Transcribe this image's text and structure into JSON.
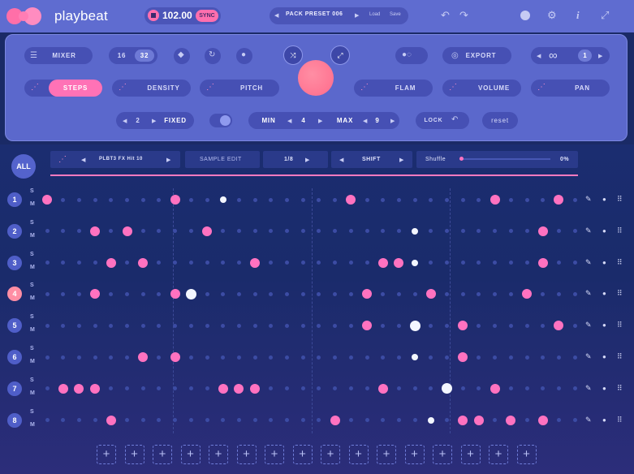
{
  "app": {
    "brand": "playbeat",
    "logo_icon": "playbeat-logo-icon"
  },
  "transport": {
    "bpm": "102.00",
    "sync_label": "SYNC"
  },
  "preset": {
    "name": "PACK PRESET 006",
    "load_label": "Load",
    "save_label": "Save"
  },
  "top_icons": [
    "undo-icon",
    "redo-icon",
    "record-icon",
    "settings-gear-icon",
    "info-icon",
    "expand-icon"
  ],
  "controls": {
    "mixer_label": "MIXER",
    "steps_16": "16",
    "steps_32": "32",
    "export_label": "EXPORT",
    "loop_count": "1",
    "steps_label": "STEPS",
    "density_label": "DENSITY",
    "pitch_label": "PITCH",
    "flam_label": "FLAM",
    "volume_label": "VOLUME",
    "pan_label": "PAN",
    "fixed_value": "2",
    "fixed_label": "FIXED",
    "min_label": "MIN",
    "min_value": "4",
    "max_label": "MAX",
    "max_value": "9",
    "lock_label": "LOCK",
    "reset_label": "reset"
  },
  "sequencer": {
    "all_label": "ALL",
    "sample_name": "PLBT3 FX Hit 10",
    "sample_edit_label": "SAMPLE EDIT",
    "division": "1/8",
    "shift_label": "SHIFT",
    "shuffle_label": "Shuffle",
    "shuffle_value": "0%",
    "solo_label": "S",
    "mute_label": "M",
    "rows": [
      {
        "num": "1",
        "steps": "p.......p..w.......p........p...p..."
      },
      {
        "num": "2",
        "steps": "...p.p....p............w.......p.."
      },
      {
        "num": "3",
        "steps": "....p.p......p.......ppw.......p.."
      },
      {
        "num": "4",
        "steps": "...p....pW..........p...p.....p."
      },
      {
        "num": "5",
        "steps": "....................p..W..p.....p.."
      },
      {
        "num": "6",
        "steps": "......p.p..............w..p.........."
      },
      {
        "num": "7",
        "steps": ".ppp.......ppp.......p...W..p.....pp"
      },
      {
        "num": "8",
        "steps": "....p.............p.....w.pp.p.p..ppp"
      }
    ],
    "add_buttons": 16
  }
}
